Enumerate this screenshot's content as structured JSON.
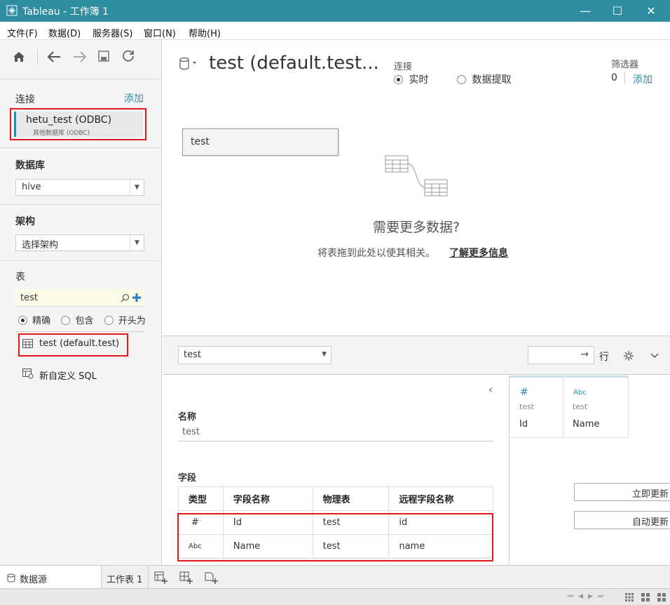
{
  "window": {
    "title": "Tableau - 工作簿 1"
  },
  "menu": [
    "文件(F)",
    "数据(D)",
    "服务器(S)",
    "窗口(N)",
    "帮助(H)"
  ],
  "left": {
    "connect_label": "连接",
    "add_label": "添加",
    "connection_name": "hetu_test (ODBC)",
    "connection_sub": "其他数据库 (ODBC)",
    "database_label": "数据库",
    "database_value": "hive",
    "schema_label": "架构",
    "schema_value": "选择架构",
    "table_label": "表",
    "search_value": "test",
    "match_options": [
      "精确",
      "包含",
      "开头为"
    ],
    "table_item": "test (default.test)",
    "custom_sql": "新自定义 SQL"
  },
  "header": {
    "ds_title": "test (default.test...",
    "conn_label": "连接",
    "live_label": "实时",
    "extract_label": "数据提取",
    "filter_label": "筛选器",
    "filter_count": "0",
    "filter_add": "添加"
  },
  "canvas": {
    "table_box": "test",
    "need_more": "需要更多数据?",
    "hint": "将表拖到此处以使其相关。",
    "learn_more": "了解更多信息"
  },
  "grid_bar": {
    "table_select": "test",
    "rows_label": "行"
  },
  "meta": {
    "name_label": "名称",
    "name_value": "test",
    "fields_label": "字段",
    "columns": [
      "类型",
      "字段名称",
      "物理表",
      "远程字段名称"
    ],
    "rows": [
      {
        "type": "#",
        "name": "Id",
        "table": "test",
        "remote": "id"
      },
      {
        "type": "Abc",
        "name": "Name",
        "table": "test",
        "remote": "name"
      }
    ]
  },
  "preview": {
    "cols": [
      {
        "type": "#",
        "table": "test",
        "name": "Id"
      },
      {
        "type": "Abc",
        "table": "test",
        "name": "Name"
      }
    ],
    "update_now": "立即更新",
    "auto_update": "自动更新"
  },
  "tabs": {
    "datasource": "数据源",
    "sheet1": "工作表 1"
  },
  "colors": {
    "accent": "#2e8e9f",
    "highlight": "#e01a1a"
  }
}
